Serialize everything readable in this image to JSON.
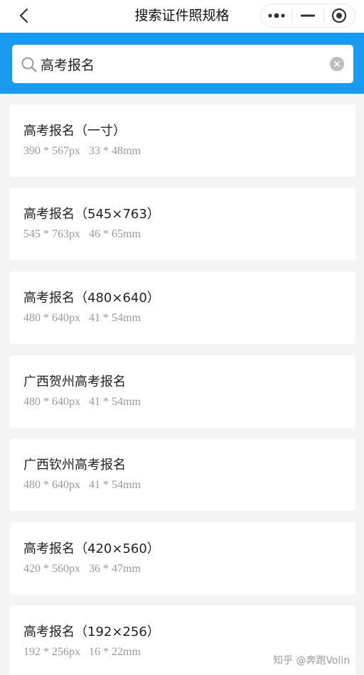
{
  "nav": {
    "title": "搜索证件照规格",
    "back_icon": "chevron-left-icon",
    "menu_icon": "more-dots-icon",
    "minimize_icon": "minimize-icon",
    "close_icon": "target-close-icon"
  },
  "search": {
    "value": "高考报名",
    "icon": "search-icon",
    "clear_icon": "clear-icon",
    "bg_color": "#1a9bf0"
  },
  "results": [
    {
      "title": "高考报名（一寸）",
      "spec": "390 * 567px   33 * 48mm"
    },
    {
      "title": "高考报名（545×763）",
      "spec": "545 * 763px   46 * 65mm"
    },
    {
      "title": "高考报名（480×640）",
      "spec": "480 * 640px   41 * 54mm"
    },
    {
      "title": "广西贺州高考报名",
      "spec": "480 * 640px   41 * 54mm"
    },
    {
      "title": "广西钦州高考报名",
      "spec": "480 * 640px   41 * 54mm"
    },
    {
      "title": "高考报名（420×560）",
      "spec": "420 * 560px   36 * 47mm"
    },
    {
      "title": "高考报名（192×256）",
      "spec": "192 * 256px   16 * 22mm"
    }
  ],
  "watermark": "知乎 @奔跑Volin"
}
